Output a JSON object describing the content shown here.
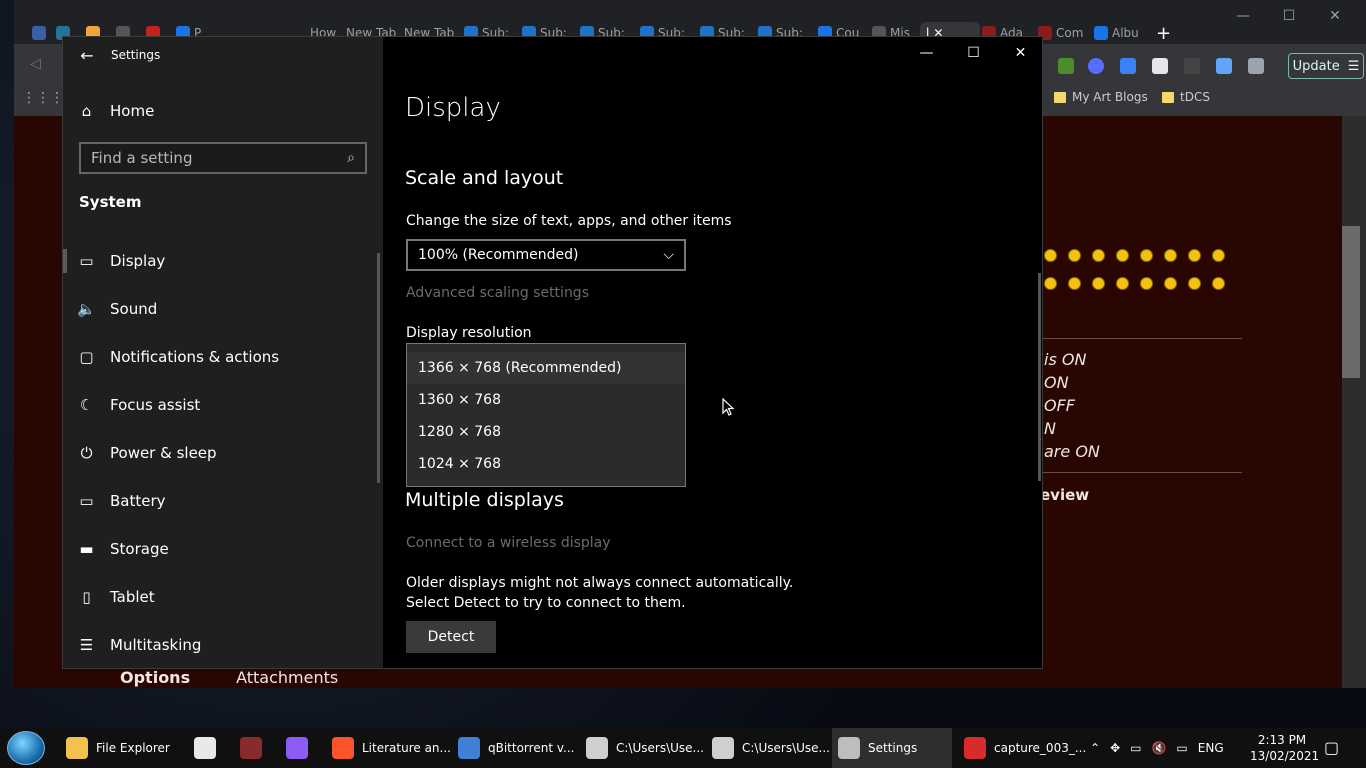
{
  "browser": {
    "tabs": [
      "P",
      "How",
      "New Tab",
      "New Tab",
      "Sub:",
      "Sub:",
      "Sub:",
      "Sub:",
      "Sub:",
      "Sub:",
      "Cou",
      "Mis",
      "l",
      "Ada",
      "Com",
      "Albu"
    ],
    "bookmarks": [
      "My Art Blogs",
      "tDCS"
    ],
    "update_label": "Update",
    "page": {
      "status_lines": [
        "is ON",
        "ON",
        "OFF",
        "N",
        "are ON"
      ],
      "review_text": "eview",
      "bottom_tabs": [
        "Options",
        "Attachments"
      ]
    }
  },
  "settings": {
    "window_title": "Settings",
    "home_label": "Home",
    "search_placeholder": "Find a setting",
    "section": "System",
    "nav_items": [
      {
        "label": "Display",
        "icon": "monitor-icon",
        "glyph": "▭"
      },
      {
        "label": "Sound",
        "icon": "speaker-icon",
        "glyph": "🔈"
      },
      {
        "label": "Notifications & actions",
        "icon": "message-icon",
        "glyph": "▢"
      },
      {
        "label": "Focus assist",
        "icon": "moon-icon",
        "glyph": "☾"
      },
      {
        "label": "Power & sleep",
        "icon": "power-icon",
        "glyph": "⏻"
      },
      {
        "label": "Battery",
        "icon": "battery-icon",
        "glyph": "▭"
      },
      {
        "label": "Storage",
        "icon": "storage-icon",
        "glyph": "▬"
      },
      {
        "label": "Tablet",
        "icon": "tablet-icon",
        "glyph": "▯"
      },
      {
        "label": "Multitasking",
        "icon": "multitask-icon",
        "glyph": "☰"
      }
    ],
    "page_title": "Display",
    "scale_heading": "Scale and layout",
    "size_label": "Change the size of text, apps, and other items",
    "scale_value": "100% (Recommended)",
    "advanced_scaling": "Advanced scaling settings",
    "resolution_label": "Display resolution",
    "resolution_options": [
      "1366 × 768 (Recommended)",
      "1360 × 768",
      "1280 × 768",
      "1024 × 768"
    ],
    "multi_heading": "Multiple displays",
    "wireless_link": "Connect to a wireless display",
    "older_text": "Older displays might not always connect automatically. Select Detect to try to connect to them.",
    "detect_label": "Detect"
  },
  "taskbar": {
    "items": [
      {
        "label": "File Explorer",
        "color": "#f2c14e"
      },
      {
        "label": "",
        "color": "#e8e8e8"
      },
      {
        "label": "",
        "color": "#8a2a2a"
      },
      {
        "label": "",
        "color": "#8b5cf6"
      },
      {
        "label": "Literature an...",
        "color": "#fb542b"
      },
      {
        "label": "qBittorrent v...",
        "color": "#3f7fd6"
      },
      {
        "label": "C:\\Users\\Use...",
        "color": "#cfcfcf"
      },
      {
        "label": "C:\\Users\\Use...",
        "color": "#cfcfcf"
      },
      {
        "label": "Settings",
        "color": "#bdbdbd"
      },
      {
        "label": "capture_003_...",
        "color": "#d92b2b"
      }
    ],
    "language": "ENG",
    "time": "2:13 PM",
    "date": "13/02/2021"
  },
  "colors": {
    "accent": "#0078d7",
    "settings_nav_bg": "#1f1f1f",
    "settings_content_bg": "#000000",
    "page_bg": "#2a0603"
  }
}
